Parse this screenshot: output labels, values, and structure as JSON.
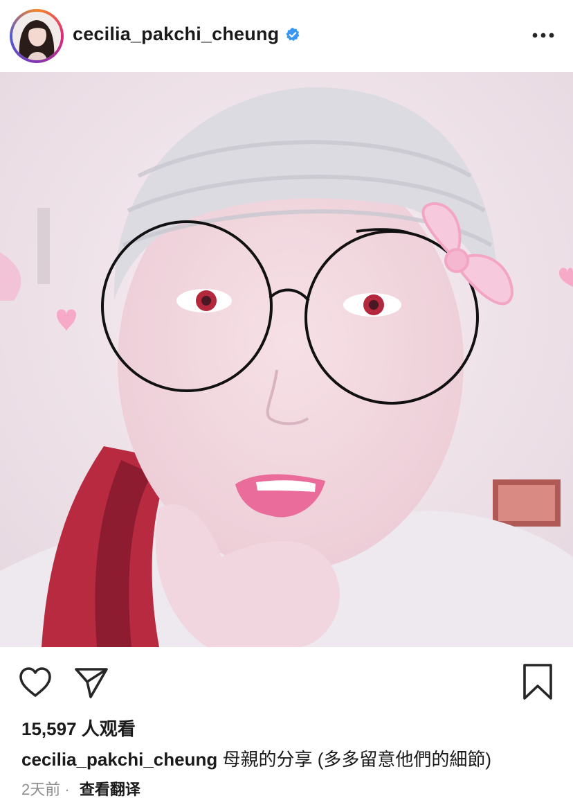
{
  "post": {
    "username": "cecilia_pakchi_cheung",
    "verified": true,
    "more_icon": "more-horizontal-icon"
  },
  "actions": {
    "like_icon": "heart-icon",
    "share_icon": "send-icon",
    "save_icon": "bookmark-icon"
  },
  "stats": {
    "views": "15,597 人观看"
  },
  "caption": {
    "username": "cecilia_pakchi_cheung",
    "text": "母親的分享 (多多留意他們的細節)"
  },
  "meta": {
    "time_ago": "2天前",
    "separator": "·",
    "translate": "查看翻译"
  },
  "colors": {
    "verified_blue": "#3897f0",
    "text_primary": "#262626",
    "text_secondary": "#8e8e8e"
  }
}
